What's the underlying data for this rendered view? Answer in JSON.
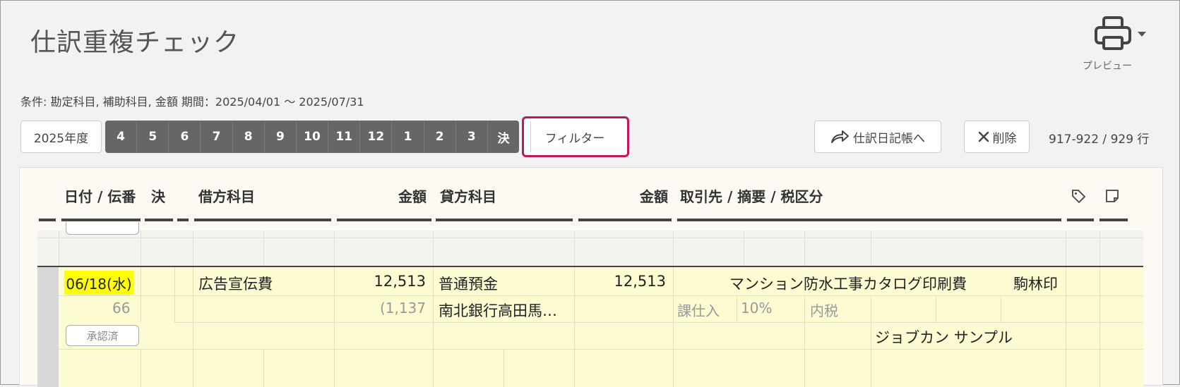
{
  "header": {
    "title": "仕訳重複チェック",
    "preview_label": "プレビュー",
    "condition": "条件: 勘定科目, 補助科目, 金額 期間：2025/04/01 〜 2025/07/31"
  },
  "toolbar": {
    "fiscal_year": "2025年度",
    "months": [
      "4",
      "5",
      "6",
      "7",
      "8",
      "9",
      "10",
      "11",
      "12",
      "1",
      "2",
      "3",
      "決"
    ],
    "filter_label": "フィルター",
    "journal_label": "仕訳日記帳へ",
    "delete_label": "削除",
    "row_count": "917-922 / 929 行"
  },
  "table": {
    "headers": {
      "date": "日付 / 伝番",
      "settle": "決",
      "debit_account": "借方科目",
      "debit_amount": "金額",
      "credit_account": "貸方科目",
      "credit_amount": "金額",
      "partner": "取引先 / 摘要 / 税区分"
    },
    "row": {
      "date": "06/18(水)",
      "slip_no": "66",
      "status": "承認済",
      "debit_account": "広告宣伝費",
      "debit_amount": "12,513",
      "debit_tax": "(1,137",
      "credit_account": "普通預金",
      "credit_sub": "南北銀行高田馬…",
      "credit_amount": "12,513",
      "description": "マンション防水工事カタログ印刷費",
      "partner": "駒林印",
      "tax_category": "課仕入",
      "tax_rate": "10%",
      "tax_type": "内税",
      "user": "ジョブカン サンプル"
    }
  }
}
